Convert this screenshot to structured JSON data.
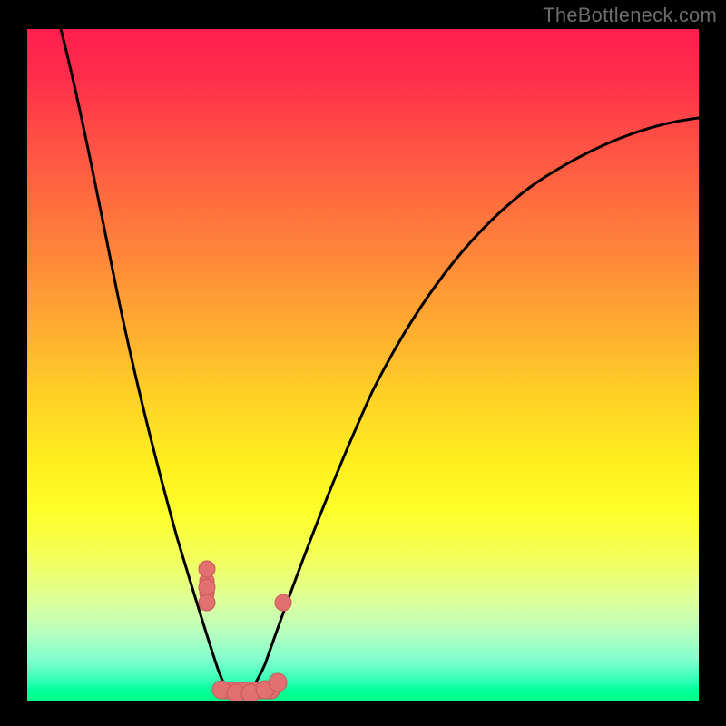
{
  "watermark": "TheBottleneck.com",
  "chart_data": {
    "type": "line",
    "title": "",
    "xlabel": "",
    "ylabel": "",
    "xlim": [
      0,
      100
    ],
    "ylim": [
      0,
      100
    ],
    "grid": false,
    "legend": false,
    "description": "V-shaped bottleneck curve with a minimum around x≈30. Background is a vertical heat gradient (red at top = high bottleneck, green at bottom = low bottleneck).",
    "x": [
      5,
      8,
      11,
      14,
      17,
      20,
      23,
      26,
      28,
      30,
      32,
      35,
      38,
      42,
      46,
      52,
      58,
      65,
      72,
      80,
      88,
      96,
      100
    ],
    "values": [
      100,
      92,
      81,
      70,
      58,
      46,
      34,
      22,
      12,
      1,
      2,
      6,
      13,
      22,
      31,
      42,
      52,
      60,
      67,
      72,
      76,
      78,
      79
    ],
    "minimum_x": 30,
    "markers": {
      "left_cluster_x": [
        26.5,
        26.6,
        26.8
      ],
      "left_cluster_y": [
        18,
        15,
        12
      ],
      "min_clump_x": [
        28.5,
        30,
        31.5,
        33,
        34.5
      ],
      "min_clump_y": [
        1.5,
        1,
        1.5,
        2.5,
        4
      ],
      "right_point_x": 36,
      "right_point_y": 15
    },
    "gradient_stops": [
      {
        "pos": 0,
        "color": "#ff1f4f"
      },
      {
        "pos": 50,
        "color": "#ffd226"
      },
      {
        "pos": 80,
        "color": "#f4ff55"
      },
      {
        "pos": 100,
        "color": "#00ff8a"
      }
    ]
  }
}
